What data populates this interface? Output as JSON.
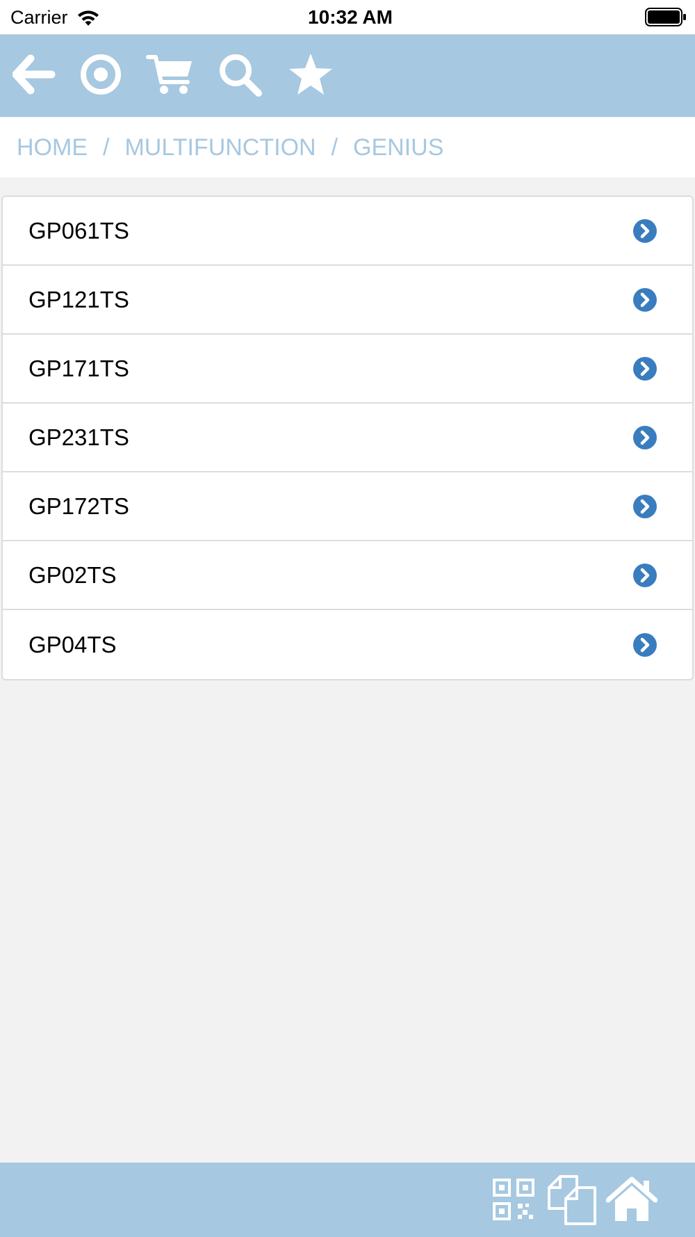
{
  "status_bar": {
    "carrier": "Carrier",
    "time": "10:32 AM",
    "icons": [
      "wifi-icon",
      "battery-icon"
    ]
  },
  "toolbar": {
    "icons": [
      "back-arrow-icon",
      "target-icon",
      "cart-icon",
      "search-icon",
      "star-icon"
    ]
  },
  "breadcrumb": {
    "items": [
      "HOME",
      "MULTIFUNCTION",
      "GENIUS"
    ],
    "separator": "/"
  },
  "list": {
    "items": [
      {
        "label": "GP061TS"
      },
      {
        "label": "GP121TS"
      },
      {
        "label": "GP171TS"
      },
      {
        "label": "GP231TS"
      },
      {
        "label": "GP172TS"
      },
      {
        "label": "GP02TS"
      },
      {
        "label": "GP04TS"
      }
    ],
    "item_icon": "chevron-right-circle-icon"
  },
  "bottom_bar": {
    "icons": [
      "qr-code-icon",
      "documents-icon",
      "home-icon"
    ]
  },
  "colors": {
    "bar_background": "#a6c8e1",
    "breadcrumb_text": "#a6c8e1",
    "chevron": "#3a7dbf",
    "page_background": "#f2f2f2"
  }
}
